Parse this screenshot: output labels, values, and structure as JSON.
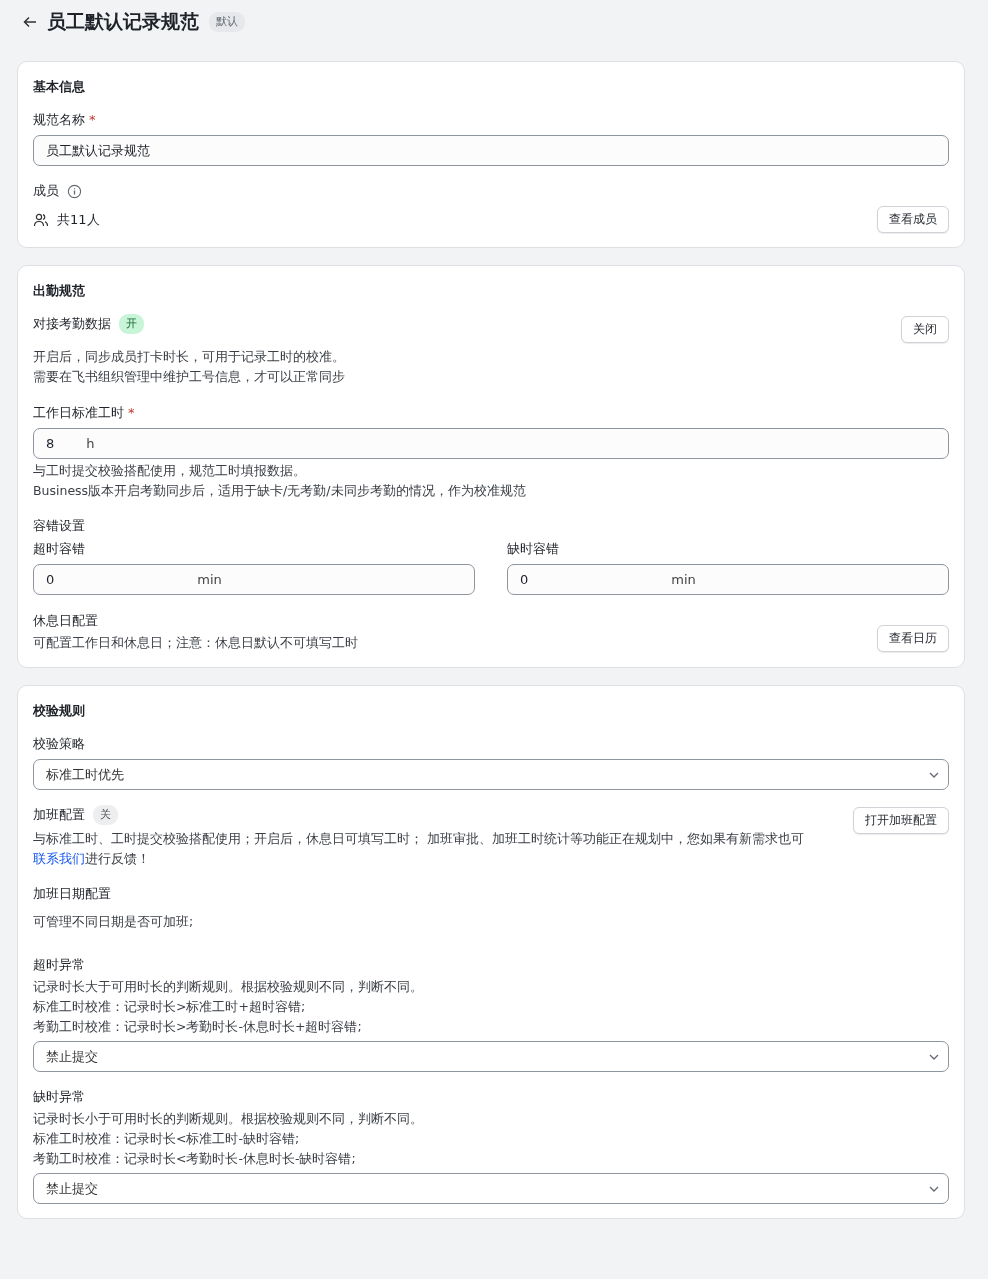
{
  "header": {
    "title": "员工默认记录规范",
    "badge": "默认"
  },
  "basic_info": {
    "title": "基本信息",
    "name_field": {
      "label": "规范名称",
      "required": true,
      "required_mark": "*",
      "value": "员工默认记录规范"
    },
    "members": {
      "label": "成员",
      "count": "共11人",
      "button": "查看成员"
    }
  },
  "attendance": {
    "title": "出勤规范",
    "sync": {
      "label": "对接考勤数据",
      "status": {
        "text": "开",
        "on": true
      },
      "button": "关闭",
      "description": [
        "开启后，同步成员打卡时长，可用于记录工时的校准。",
        "需要在飞书组织管理中维护工号信息，才可以正常同步"
      ]
    },
    "standard_hours": {
      "label": "工作日标准工时",
      "required": true,
      "required_mark": "*",
      "value": "8",
      "unit": "h",
      "help": [
        "与工时提交校验搭配使用，规范工时填报数据。",
        "Business版本开启考勤同步后，适用于缺卡/无考勤/未同步考勤的情况，作为校准规范"
      ]
    },
    "tolerance": {
      "title": "容错设置",
      "fields": [
        {
          "label": "超时容错",
          "value": "0",
          "unit": "min"
        },
        {
          "label": "缺时容错",
          "value": "0",
          "unit": "min"
        }
      ]
    },
    "rest_day": {
      "label": "休息日配置",
      "description": "可配置工作日和休息日；注意：休息日默认不可填写工时",
      "button": "查看日历"
    }
  },
  "validation": {
    "title": "校验规则",
    "strategy": {
      "label": "校验策略",
      "value": "标准工时优先"
    },
    "overtime_config": {
      "label": "加班配置",
      "status": {
        "text": "关",
        "on": false
      },
      "button": "打开加班配置",
      "description": "与标准工时、工时提交校验搭配使用；开启后，休息日可填写工时；  加班审批、加班工时统计等功能正在规划中，您如果有新需求也可",
      "link": "联系我们",
      "description_end": "进行反馈！"
    },
    "overtime_date": {
      "label": "加班日期配置",
      "description": "可管理不同日期是否可加班;"
    },
    "exceptions": [
      {
        "label": "超时异常",
        "lines": [
          "记录时长大于可用时长的判断规则。根据校验规则不同，判断不同。",
          "标准工时校准：记录时长>标准工时+超时容错;",
          "考勤工时校准：记录时长>考勤时长-休息时长+超时容错;"
        ],
        "value": "禁止提交"
      },
      {
        "label": "缺时异常",
        "lines": [
          "记录时长小于可用时长的判断规则。根据校验规则不同，判断不同。",
          "标准工时校准：记录时长<标准工时-缺时容错;",
          "考勤工时校准：记录时长<考勤时长-休息时长-缺时容错;"
        ],
        "value": "禁止提交"
      }
    ]
  }
}
